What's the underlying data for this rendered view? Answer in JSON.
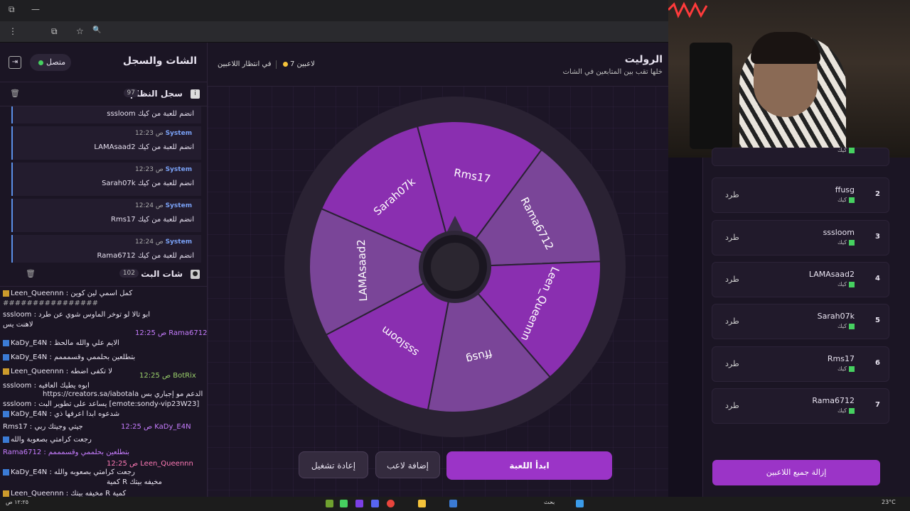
{
  "browser": {
    "window_controls": [
      "⧉",
      "—"
    ],
    "address_icons": [
      "⋮",
      "⧉",
      "☆",
      "🔍"
    ]
  },
  "chat_panel": {
    "title": "الشات والسجل",
    "status": "متصل",
    "system_log": {
      "title": "سجل النظام",
      "count": "97",
      "messages": [
        {
          "time": "",
          "sender": "",
          "text": "sssloom انضم للعبة من كيك"
        },
        {
          "time": "12:23 ص",
          "sender": "System",
          "text": "LAMAsaad2 انضم للعبة من كيك"
        },
        {
          "time": "12:23 ص",
          "sender": "System",
          "text": "Sarah07k انضم للعبة من كيك"
        },
        {
          "time": "12:24 ص",
          "sender": "System",
          "text": "Rms17 انضم للعبة من كيك"
        },
        {
          "time": "12:24 ص",
          "sender": "System",
          "text": "Rama6712 انضم للعبة من كيك"
        }
      ]
    },
    "stream_chat": {
      "title": "شات البث",
      "count": "102",
      "lines": [
        "Leen_Queennn : كمل اسمي لين كوين",
        "################",
        "sssloom : ابو تالا لو توخر الماوس شوي عن طرد",
        "لاهنت يس",
        "12:25 ص Rama6712",
        "KaDy_E4N : الايم علي والله مالحظ",
        "KaDy_E4N : بتطلعين بحلممي وقسمممم",
        "Leen_Queennn : لا تكفى اضطه",
        "12:25 ص BotRix",
        "sssloom : ابوه يطيك العافيه",
        "https://creators.sa/iabotala الدعم مو إجباري بس",
        "sssloom : يساعد على تطوير البث [emote:sondy-vip23W23]",
        "KaDy_E4N : شدعوه ابدا اعرفها ذي",
        "Rms17 : جيتي وجيتك ربي",
        "12:25 ص KaDy_E4N",
        "رجعت كرامتي بصعوبة والله",
        "Rama6712 : بتطلعين بحلممي وقسمممم",
        "12:25 ص Leen_Queennn",
        "KaDy_E4N : رجعت كرامتي بصعوبه والله",
        "كمية R مخيفه بيتك",
        "Leen_Queennn : مخيفه بيتك R كمية"
      ]
    }
  },
  "game": {
    "title": "الروليت",
    "subtitle": "خلها تقب بين المتابعين في الشات",
    "players_count": "7 لاعبين",
    "state": "في انتظار اللاعبين",
    "wheel": [
      "Rms17",
      "Rama6712",
      "Leen_Queennn",
      "ffusg",
      "sssloom",
      "LAMAsaad2",
      "Sarah07k"
    ],
    "wheel_colors": [
      "#8a2fb0",
      "#7a4598"
    ],
    "start_button": "ابدأ اللعبة",
    "add_button": "إضافة لاعب",
    "reset_button": "إعادة تشغيل"
  },
  "players": {
    "items": [
      {
        "num": "2",
        "name": "ffusg",
        "platform": "كيك",
        "kick": "طرد"
      },
      {
        "num": "3",
        "name": "sssloom",
        "platform": "كيك",
        "kick": "طرد"
      },
      {
        "num": "4",
        "name": "LAMAsaad2",
        "platform": "كيك",
        "kick": "طرد"
      },
      {
        "num": "5",
        "name": "Sarah07k",
        "platform": "كيك",
        "kick": "طرد"
      },
      {
        "num": "6",
        "name": "Rms17",
        "platform": "كيك",
        "kick": "طرد"
      },
      {
        "num": "7",
        "name": "Rama6712",
        "platform": "كيك",
        "kick": "طرد"
      }
    ],
    "first_partial_platform": "كيك",
    "remove_all": "إزالة جميع اللاعبين"
  },
  "taskbar": {
    "search": "بحث",
    "clock": "١٢:٢٥ ص",
    "weather": "23°C"
  },
  "colors": {
    "accent": "#9b34c7",
    "online": "#46d160",
    "system": "#7aa2f7"
  }
}
